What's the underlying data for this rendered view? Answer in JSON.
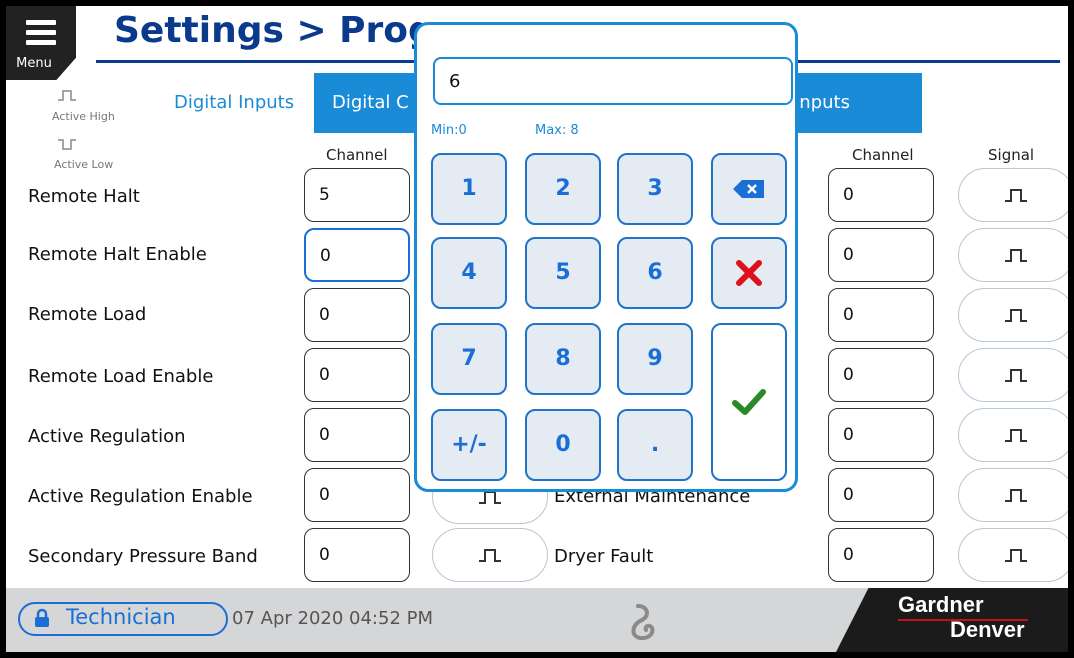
{
  "header": {
    "menu_label": "Menu",
    "title": "Settings > Prog"
  },
  "legend": {
    "active_high": "Active High",
    "active_low": "Active Low"
  },
  "tabs": [
    {
      "label": "Digital Inputs"
    },
    {
      "label": "Digital C"
    },
    {
      "label": "Inputs"
    }
  ],
  "column_headers": {
    "left_channel": "Channel",
    "right_channel": "Channel",
    "right_signal": "Signal"
  },
  "left_rows": [
    {
      "label": "Remote Halt",
      "channel": "5"
    },
    {
      "label": "Remote Halt Enable",
      "channel": "0"
    },
    {
      "label": "Remote Load",
      "channel": "0"
    },
    {
      "label": "Remote Load Enable",
      "channel": "0"
    },
    {
      "label": "Active Regulation",
      "channel": "0"
    },
    {
      "label": "Active Regulation Enable",
      "channel": "0"
    },
    {
      "label": "Secondary Pressure Band",
      "channel": "0"
    }
  ],
  "right_rows": [
    {
      "label": "",
      "channel": "0"
    },
    {
      "label": "",
      "channel": "0"
    },
    {
      "label": "",
      "channel": "0"
    },
    {
      "label": "",
      "channel": "0"
    },
    {
      "label": "",
      "channel": "0"
    },
    {
      "label": "External Maintenance",
      "channel": "0"
    },
    {
      "label": "Dryer Fault",
      "channel": "0"
    }
  ],
  "keypad": {
    "value": "6",
    "min_label": "Min:0",
    "max_label": "Max: 8",
    "keys": [
      "1",
      "2",
      "3",
      "4",
      "5",
      "6",
      "7",
      "8",
      "9",
      "+/-",
      "0",
      "."
    ]
  },
  "status": {
    "user": "Technician",
    "datetime": "07 Apr 2020 04:52 PM",
    "brand_line1": "Gardner",
    "brand_line2": "Denver"
  },
  "colors": {
    "accent": "#1a8bd6",
    "title": "#0a3a8c",
    "cancel": "#e0101a",
    "confirm": "#2a8a2a"
  }
}
